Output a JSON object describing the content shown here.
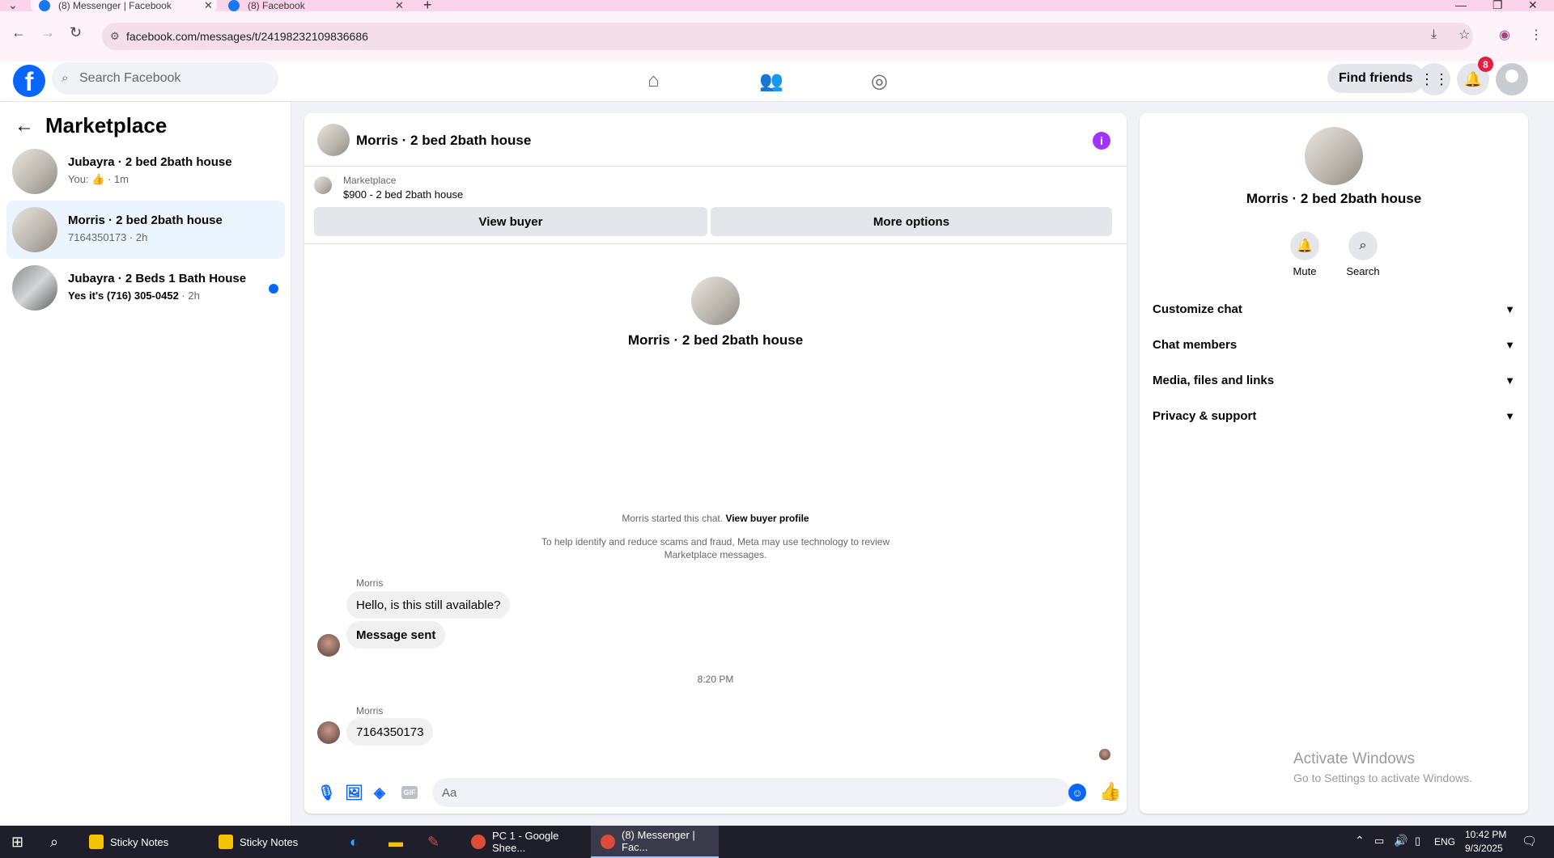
{
  "browser": {
    "tabs": [
      {
        "title": "(8) Messenger | Facebook"
      },
      {
        "title": "(8) Facebook"
      }
    ],
    "url": "facebook.com/messages/t/24198232109836686"
  },
  "fb_header": {
    "search_placeholder": "Search Facebook",
    "find_friends": "Find friends",
    "notification_count": "8"
  },
  "sidebar": {
    "title": "Marketplace",
    "conversations": [
      {
        "name": "Jubayra · 2 bed 2bath house",
        "preview": "You: 👍 · 1m",
        "unread": false
      },
      {
        "name": "Morris · 2 bed 2bath house",
        "preview": "7164350173 · 2h",
        "unread": false
      },
      {
        "name": "Jubayra · 2 Beds 1 Bath House",
        "preview": "Yes it's (716) 305-0452",
        "time": " · 2h",
        "unread": true
      }
    ]
  },
  "chat": {
    "title": "Morris · 2 bed 2bath house",
    "marketplace_label": "Marketplace",
    "listing": "$900 - 2 bed 2bath house",
    "view_buyer": "View buyer",
    "more_options": "More options",
    "intro_name": "Morris · 2 bed 2bath house",
    "started_text": "Morris started this chat. ",
    "view_buyer_profile": "View buyer profile",
    "scam_notice": "To help identify and reduce scams and fraud, Meta may use technology to review Marketplace messages.",
    "messages": [
      {
        "sender": "Morris",
        "text": "Hello, is this still available?"
      },
      {
        "sender": "",
        "text": "Message sent"
      },
      {
        "timestamp": "8:20 PM"
      },
      {
        "sender": "Morris",
        "text": "7164350173"
      }
    ],
    "composer_placeholder": "Aa"
  },
  "right_panel": {
    "name": "Morris · 2 bed 2bath house",
    "actions": [
      {
        "label": "Mute",
        "icon": "bell-icon"
      },
      {
        "label": "Search",
        "icon": "search-icon"
      }
    ],
    "sections": [
      "Customize chat",
      "Chat members",
      "Media, files and links",
      "Privacy & support"
    ],
    "watermark_title": "Activate Windows",
    "watermark_sub": "Go to Settings to activate Windows."
  },
  "taskbar": {
    "apps": [
      {
        "label": "Sticky Notes",
        "color": "#f5c400"
      },
      {
        "label": "Sticky Notes",
        "color": "#f5c400"
      },
      {
        "label": "PC 1 - Google Shee...",
        "color": "#dd4b39"
      },
      {
        "label": "(8) Messenger | Fac...",
        "color": "#dd4b39"
      }
    ],
    "lang": "ENG",
    "time": "10:42 PM",
    "date": "9/3/2025"
  },
  "colors": {
    "brand": "#0866ff",
    "info": "#a033ff",
    "badge": "#e41e3f"
  }
}
